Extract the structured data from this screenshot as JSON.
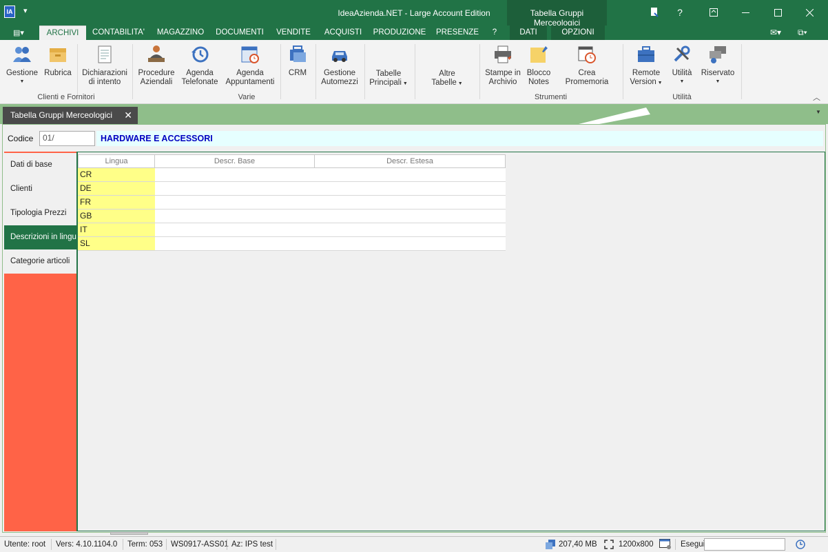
{
  "window": {
    "title": "IdeaAzienda.NET - Large Account Edition",
    "app_icon_text": "IA",
    "context_tab": "Tabella Gruppi Merceologici",
    "help": "?"
  },
  "ribbon_tabs": [
    "ARCHIVI",
    "CONTABILITA'",
    "MAGAZZINO",
    "DOCUMENTI",
    "VENDITE",
    "ACQUISTI",
    "PRODUZIONE",
    "PRESENZE",
    "?",
    "DATI",
    "OPZIONI"
  ],
  "ribbon": {
    "buttons": {
      "gestione": "Gestione",
      "rubrica": "Rubrica",
      "dichiarazioni_1": "Dichiarazioni",
      "dichiarazioni_2": "di intento",
      "procedure_1": "Procedure",
      "procedure_2": "Aziendali",
      "agenda_tel_1": "Agenda",
      "agenda_tel_2": "Telefonate",
      "agenda_app_1": "Agenda",
      "agenda_app_2": "Appuntamenti",
      "crm": "CRM",
      "automezzi_1": "Gestione",
      "automezzi_2": "Automezzi",
      "tabelle_1": "Tabelle",
      "tabelle_2": "Principali",
      "altre_1": "Altre",
      "altre_2": "Tabelle",
      "stampe_1": "Stampe in",
      "stampe_2": "Archivio",
      "blocco_1": "Blocco",
      "blocco_2": "Notes",
      "promemoria": "Crea Promemoria",
      "remote_1": "Remote",
      "remote_2": "Version",
      "utilita": "Utilità",
      "riservato": "Riservato"
    },
    "groups": {
      "clienti_fornitori": "Clienti e Fornitori",
      "varie": "Varie",
      "strumenti": "Strumenti",
      "utilita": "Utilità"
    }
  },
  "doc_tab": {
    "label": "Tabella Gruppi Merceologici",
    "close": "✕"
  },
  "record": {
    "codice_label": "Codice",
    "codice_value": "01/",
    "descrizione": "HARDWARE E ACCESSORI"
  },
  "side_nav": [
    "Dati di base",
    "Clienti",
    "Tipologia Prezzi",
    "Descrizioni in lingua",
    "Categorie articoli"
  ],
  "grid": {
    "columns": [
      "Lingua",
      "Descr. Base",
      "Descr. Estesa"
    ],
    "rows": [
      {
        "lingua": "CR",
        "base": "",
        "estesa": ""
      },
      {
        "lingua": "DE",
        "base": "",
        "estesa": ""
      },
      {
        "lingua": "FR",
        "base": "",
        "estesa": ""
      },
      {
        "lingua": "GB",
        "base": "",
        "estesa": ""
      },
      {
        "lingua": "IT",
        "base": "",
        "estesa": ""
      },
      {
        "lingua": "SL",
        "base": "",
        "estesa": ""
      }
    ]
  },
  "status": {
    "utente": "Utente: root",
    "versione": "Vers: 4.10.1104.0",
    "term": "Term: 053",
    "workstation": "WS0917-ASS01",
    "azienda": "Az: IPS test",
    "memory": "207,40 MB",
    "resolution": "1200x800",
    "esegui": "Esegui"
  }
}
